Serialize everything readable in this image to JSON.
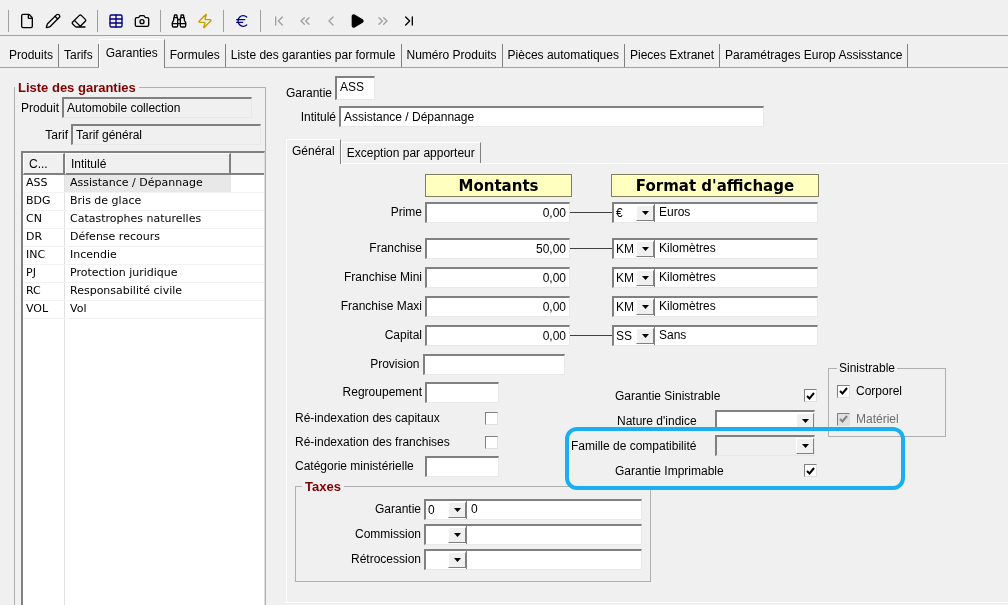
{
  "tabs": [
    {
      "label": "Produits",
      "selected": false
    },
    {
      "label": "Tarifs",
      "selected": false
    },
    {
      "label": "Garanties",
      "selected": true
    },
    {
      "label": "Formules",
      "selected": false
    },
    {
      "label": "Liste des garanties par formule",
      "selected": false
    },
    {
      "label": "Numéro Produits",
      "selected": false
    },
    {
      "label": "Pièces automatiques",
      "selected": false
    },
    {
      "label": "Pieces  Extranet",
      "selected": false
    },
    {
      "label": "Paramétrages Europ Assisstance",
      "selected": false
    }
  ],
  "list_panel": {
    "title": "Liste des garanties",
    "produit": {
      "label": "Produit",
      "value": "Automobile collection"
    },
    "tarif": {
      "label": "Tarif",
      "value": "Tarif général"
    },
    "columns": [
      "C...",
      "Intitulé"
    ],
    "rows": [
      {
        "code": "ASS",
        "label": "Assistance / Dépannage",
        "selected": true
      },
      {
        "code": "BDG",
        "label": "Bris de glace",
        "selected": false
      },
      {
        "code": "CN",
        "label": "Catastrophes naturelles",
        "selected": false
      },
      {
        "code": "DR",
        "label": "Défense recours",
        "selected": false
      },
      {
        "code": "INC",
        "label": "Incendie",
        "selected": false
      },
      {
        "code": "PJ",
        "label": "Protection juridique",
        "selected": false
      },
      {
        "code": "RC",
        "label": "Responsabilité civile",
        "selected": false
      },
      {
        "code": "VOL",
        "label": "Vol",
        "selected": false
      }
    ]
  },
  "detail": {
    "garantie": {
      "label": "Garantie",
      "value": "ASS"
    },
    "intitule": {
      "label": "Intitulé",
      "value": "Assistance / Dépannage"
    },
    "subtabs": [
      {
        "label": "Général",
        "selected": true
      },
      {
        "label": "Exception par apporteur",
        "selected": false
      }
    ],
    "headers": {
      "amounts": "Montants",
      "format": "Format d'affichage"
    },
    "amount_rows": [
      {
        "label": "Prime",
        "amount": "0,00",
        "code": "€",
        "format": "Euros",
        "linked": true
      },
      {
        "label": "Franchise",
        "amount": "50,00",
        "code": "KM",
        "format": "Kilomètres",
        "linked": true
      },
      {
        "label": "Franchise Mini",
        "amount": "0,00",
        "code": "KM",
        "format": "Kilomètres",
        "linked": false
      },
      {
        "label": "Franchise Maxi",
        "amount": "0,00",
        "code": "KM",
        "format": "Kilomètres",
        "linked": false
      },
      {
        "label": "Capital",
        "amount": "0,00",
        "code": "SS",
        "format": "Sans",
        "linked": true
      }
    ],
    "provision": {
      "label": "Provision"
    },
    "regroupement": {
      "label": "Regroupement"
    },
    "reindex": [
      {
        "label": "Ré-indexation des capitaux",
        "checked": false
      },
      {
        "label": "Ré-indexation des franchises",
        "checked": false
      }
    ],
    "categorie": {
      "label": "Catégorie ministérielle"
    },
    "taxes": {
      "title": "Taxes",
      "rows": [
        {
          "label": "Garantie",
          "code": "0",
          "value": "0"
        },
        {
          "label": "Commission"
        },
        {
          "label": "Rétrocession"
        }
      ]
    },
    "sinistrable_check": {
      "label": "Garantie Sinistrable",
      "checked": true
    },
    "nature": {
      "label": "Nature d'indice"
    },
    "famille": {
      "label": "Famille de compatibilité",
      "disabled": true
    },
    "imprimable": {
      "label": "Garantie Imprimable",
      "checked": true
    },
    "sinistrable_group": {
      "title": "Sinistrable",
      "items": [
        {
          "label": "Corporel",
          "checked": true,
          "disabled": false
        },
        {
          "label": "Matériel",
          "checked": true,
          "disabled": true
        }
      ]
    }
  }
}
